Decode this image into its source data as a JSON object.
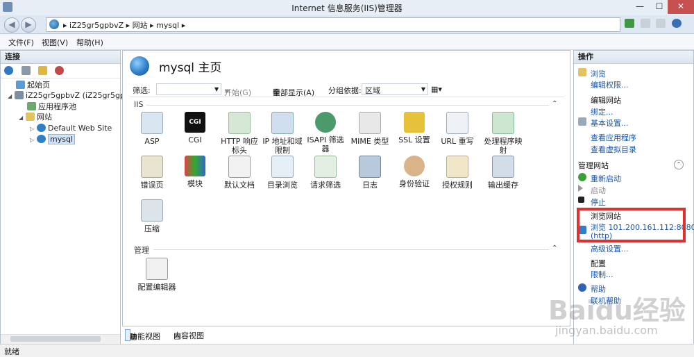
{
  "window": {
    "title": "Internet 信息服务(IIS)管理器",
    "min": "—",
    "max": "☐",
    "close": "✕"
  },
  "address": {
    "crumbs": [
      "iZ25gr5gpbvZ",
      "网站",
      "mysql"
    ],
    "sep": "▸"
  },
  "menu": [
    "文件(F)",
    "视图(V)",
    "帮助(H)"
  ],
  "connections": {
    "header": "连接",
    "tree": [
      {
        "label": "起始页"
      },
      {
        "label": "iZ25gr5gpbvZ (iZ25gr5gpb"
      },
      {
        "label": "应用程序池"
      },
      {
        "label": "网站"
      },
      {
        "label": "Default Web Site"
      },
      {
        "label": "mysql"
      }
    ]
  },
  "main": {
    "title": "mysql 主页",
    "filter_label": "筛选:",
    "start_label": "开始(G)",
    "showall_label": "全部显示(A)",
    "groupby_label": "分组依据:",
    "groupby_value": "区域",
    "section_iis": "IIS",
    "section_manage": "管理",
    "features_iis": [
      [
        "ASP",
        "CGI",
        "HTTP 响应标头",
        "IP 地址和域限制",
        "ISAPI 筛选器",
        "MIME 类型",
        "SSL 设置",
        "URL 重写",
        "处理程序映射"
      ],
      [
        "错误页",
        "模块",
        "默认文档",
        "目录浏览",
        "请求筛选",
        "日志",
        "身份验证",
        "授权规则",
        "输出缓存"
      ],
      [
        "压缩"
      ]
    ],
    "features_manage": [
      "配置编辑器"
    ],
    "cgi_badge": "CGI"
  },
  "tabs": {
    "features": "功能视图",
    "content": "内容视图"
  },
  "actions": {
    "header": "操作",
    "browse": "浏览",
    "edit_perms": "编辑权限...",
    "edit_site_hdr": "编辑网站",
    "bindings": "绑定...",
    "basic_settings": "基本设置...",
    "view_apps": "查看应用程序",
    "view_vdirs": "查看虚拟目录",
    "manage_site_hdr": "管理网站",
    "restart": "重新启动",
    "start": "启动",
    "stop": "停止",
    "browse_site_hdr": "浏览网站",
    "browse_url": "浏览 101.200.161.112:8080",
    "browse_url2": "(http)",
    "advanced": "高级设置...",
    "config_hdr": "配置",
    "limits": "限制...",
    "help": "帮助",
    "online_help": "联机帮助"
  },
  "status": "就绪",
  "watermark": {
    "main": "Baidu经验",
    "sub": "jingyan.baidu.com"
  }
}
